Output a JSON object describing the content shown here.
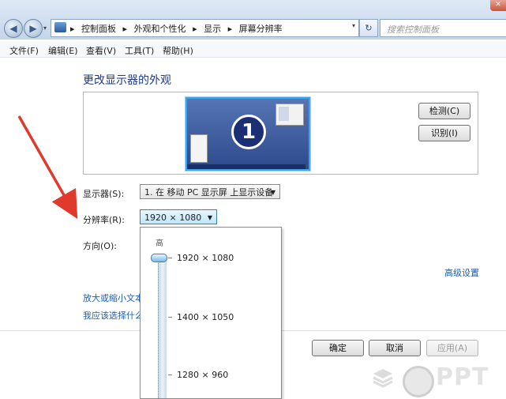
{
  "window": {
    "close_glyph": "✕"
  },
  "nav": {
    "back_glyph": "◀",
    "forward_glyph": "▶",
    "history_glyph": "▾"
  },
  "address": {
    "icon": "control-panel-icon",
    "crumbs": [
      "▸",
      "控制面板",
      "▸",
      "外观和个性化",
      "▸",
      "显示",
      "▸",
      "屏幕分辨率"
    ],
    "dropdown_glyph": "▾",
    "refresh_glyph": "↻"
  },
  "search": {
    "placeholder": "搜索控制面板"
  },
  "menu": [
    "文件(F)",
    "编辑(E)",
    "查看(V)",
    "工具(T)",
    "帮助(H)"
  ],
  "main": {
    "heading": "更改显示器的外观",
    "monitor_number": "1",
    "detect_label": "检测(C)",
    "identify_label": "识别(I)",
    "display_label": "显示器(S):",
    "display_value": "1. 在 移动 PC 显示屏 上显示设备",
    "resolution_label": "分辨率(R):",
    "resolution_value": "1920 × 1080",
    "orientation_label": "方向(O):",
    "advanced_link": "高级设置",
    "link_text_size": "放大或缩小文本",
    "link_which_settings": "我应该选择什么"
  },
  "dropdown": {
    "high_label": "高",
    "options": [
      "1920 × 1080",
      "1400 × 1050",
      "1280 × 960"
    ],
    "selected_index": 0
  },
  "footer": {
    "ok_label": "确定",
    "cancel_label": "取消",
    "apply_label": "应用(A)"
  },
  "watermark": {
    "text": "PPT"
  },
  "colors": {
    "accent": "#1a5fb4",
    "arrow": "#e03a2c",
    "heading": "#1e3a8a"
  }
}
